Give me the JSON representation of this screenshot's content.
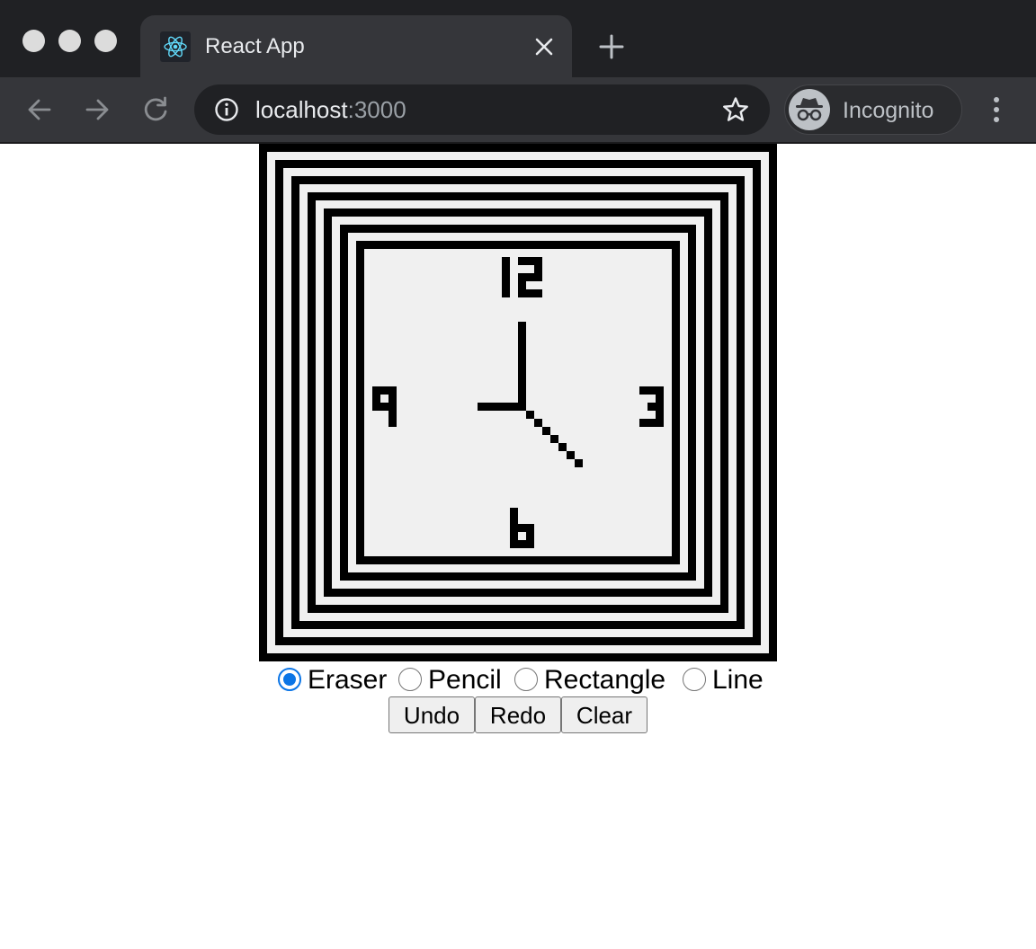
{
  "browser": {
    "tab_title": "React App",
    "url_host": "localhost",
    "url_port": ":3000",
    "profile_label": "Incognito",
    "favicon": "react-logo-icon",
    "icons": {
      "back": "arrow-left-icon",
      "forward": "arrow-right-icon",
      "reload": "reload-icon",
      "info": "info-icon",
      "star": "star-icon",
      "menu": "kebab-menu-icon",
      "new_tab": "plus-icon",
      "close_tab": "close-icon"
    }
  },
  "app": {
    "canvas": {
      "background": "#f0f0f0",
      "ink": "#000000",
      "clock_numbers": [
        "12",
        "3",
        "6",
        "9"
      ],
      "description_shown": false
    },
    "tools": [
      {
        "label": "Eraser",
        "checked": true
      },
      {
        "label": "Pencil",
        "checked": false
      },
      {
        "label": "Rectangle",
        "checked": false
      },
      {
        "label": "Line",
        "checked": false
      }
    ],
    "buttons": {
      "undo": "Undo",
      "redo": "Redo",
      "clear": "Clear"
    }
  },
  "colors": {
    "tabstrip": "#202124",
    "toolbar": "#35363a",
    "accent": "#0b75e6"
  }
}
